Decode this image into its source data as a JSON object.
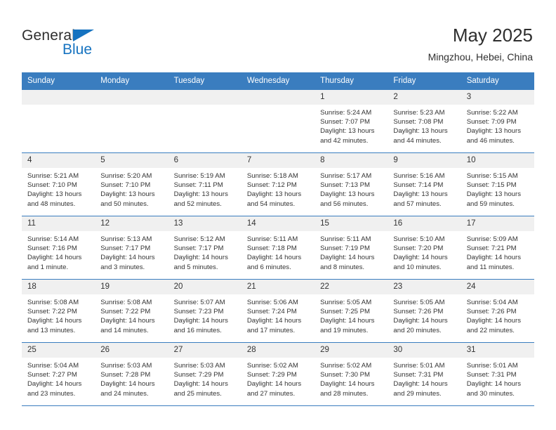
{
  "brand": {
    "word1": "General",
    "word2": "Blue",
    "triangle_color": "#1673c0"
  },
  "header": {
    "title": "May 2025",
    "subtitle": "Mingzhou, Hebei, China",
    "header_bg": "#3a7dbf",
    "daynum_bg": "#f0f0f0"
  },
  "weekdays": [
    "Sunday",
    "Monday",
    "Tuesday",
    "Wednesday",
    "Thursday",
    "Friday",
    "Saturday"
  ],
  "labels": {
    "sunrise": "Sunrise:",
    "sunset": "Sunset:",
    "daylight": "Daylight:"
  },
  "weeks": [
    [
      {
        "day": "",
        "empty": true
      },
      {
        "day": "",
        "empty": true
      },
      {
        "day": "",
        "empty": true
      },
      {
        "day": "",
        "empty": true
      },
      {
        "day": "1",
        "sunrise": "Sunrise: 5:24 AM",
        "sunset": "Sunset: 7:07 PM",
        "daylight": "Daylight: 13 hours and 42 minutes."
      },
      {
        "day": "2",
        "sunrise": "Sunrise: 5:23 AM",
        "sunset": "Sunset: 7:08 PM",
        "daylight": "Daylight: 13 hours and 44 minutes."
      },
      {
        "day": "3",
        "sunrise": "Sunrise: 5:22 AM",
        "sunset": "Sunset: 7:09 PM",
        "daylight": "Daylight: 13 hours and 46 minutes."
      }
    ],
    [
      {
        "day": "4",
        "sunrise": "Sunrise: 5:21 AM",
        "sunset": "Sunset: 7:10 PM",
        "daylight": "Daylight: 13 hours and 48 minutes."
      },
      {
        "day": "5",
        "sunrise": "Sunrise: 5:20 AM",
        "sunset": "Sunset: 7:10 PM",
        "daylight": "Daylight: 13 hours and 50 minutes."
      },
      {
        "day": "6",
        "sunrise": "Sunrise: 5:19 AM",
        "sunset": "Sunset: 7:11 PM",
        "daylight": "Daylight: 13 hours and 52 minutes."
      },
      {
        "day": "7",
        "sunrise": "Sunrise: 5:18 AM",
        "sunset": "Sunset: 7:12 PM",
        "daylight": "Daylight: 13 hours and 54 minutes."
      },
      {
        "day": "8",
        "sunrise": "Sunrise: 5:17 AM",
        "sunset": "Sunset: 7:13 PM",
        "daylight": "Daylight: 13 hours and 56 minutes."
      },
      {
        "day": "9",
        "sunrise": "Sunrise: 5:16 AM",
        "sunset": "Sunset: 7:14 PM",
        "daylight": "Daylight: 13 hours and 57 minutes."
      },
      {
        "day": "10",
        "sunrise": "Sunrise: 5:15 AM",
        "sunset": "Sunset: 7:15 PM",
        "daylight": "Daylight: 13 hours and 59 minutes."
      }
    ],
    [
      {
        "day": "11",
        "sunrise": "Sunrise: 5:14 AM",
        "sunset": "Sunset: 7:16 PM",
        "daylight": "Daylight: 14 hours and 1 minute."
      },
      {
        "day": "12",
        "sunrise": "Sunrise: 5:13 AM",
        "sunset": "Sunset: 7:17 PM",
        "daylight": "Daylight: 14 hours and 3 minutes."
      },
      {
        "day": "13",
        "sunrise": "Sunrise: 5:12 AM",
        "sunset": "Sunset: 7:17 PM",
        "daylight": "Daylight: 14 hours and 5 minutes."
      },
      {
        "day": "14",
        "sunrise": "Sunrise: 5:11 AM",
        "sunset": "Sunset: 7:18 PM",
        "daylight": "Daylight: 14 hours and 6 minutes."
      },
      {
        "day": "15",
        "sunrise": "Sunrise: 5:11 AM",
        "sunset": "Sunset: 7:19 PM",
        "daylight": "Daylight: 14 hours and 8 minutes."
      },
      {
        "day": "16",
        "sunrise": "Sunrise: 5:10 AM",
        "sunset": "Sunset: 7:20 PM",
        "daylight": "Daylight: 14 hours and 10 minutes."
      },
      {
        "day": "17",
        "sunrise": "Sunrise: 5:09 AM",
        "sunset": "Sunset: 7:21 PM",
        "daylight": "Daylight: 14 hours and 11 minutes."
      }
    ],
    [
      {
        "day": "18",
        "sunrise": "Sunrise: 5:08 AM",
        "sunset": "Sunset: 7:22 PM",
        "daylight": "Daylight: 14 hours and 13 minutes."
      },
      {
        "day": "19",
        "sunrise": "Sunrise: 5:08 AM",
        "sunset": "Sunset: 7:22 PM",
        "daylight": "Daylight: 14 hours and 14 minutes."
      },
      {
        "day": "20",
        "sunrise": "Sunrise: 5:07 AM",
        "sunset": "Sunset: 7:23 PM",
        "daylight": "Daylight: 14 hours and 16 minutes."
      },
      {
        "day": "21",
        "sunrise": "Sunrise: 5:06 AM",
        "sunset": "Sunset: 7:24 PM",
        "daylight": "Daylight: 14 hours and 17 minutes."
      },
      {
        "day": "22",
        "sunrise": "Sunrise: 5:05 AM",
        "sunset": "Sunset: 7:25 PM",
        "daylight": "Daylight: 14 hours and 19 minutes."
      },
      {
        "day": "23",
        "sunrise": "Sunrise: 5:05 AM",
        "sunset": "Sunset: 7:26 PM",
        "daylight": "Daylight: 14 hours and 20 minutes."
      },
      {
        "day": "24",
        "sunrise": "Sunrise: 5:04 AM",
        "sunset": "Sunset: 7:26 PM",
        "daylight": "Daylight: 14 hours and 22 minutes."
      }
    ],
    [
      {
        "day": "25",
        "sunrise": "Sunrise: 5:04 AM",
        "sunset": "Sunset: 7:27 PM",
        "daylight": "Daylight: 14 hours and 23 minutes."
      },
      {
        "day": "26",
        "sunrise": "Sunrise: 5:03 AM",
        "sunset": "Sunset: 7:28 PM",
        "daylight": "Daylight: 14 hours and 24 minutes."
      },
      {
        "day": "27",
        "sunrise": "Sunrise: 5:03 AM",
        "sunset": "Sunset: 7:29 PM",
        "daylight": "Daylight: 14 hours and 25 minutes."
      },
      {
        "day": "28",
        "sunrise": "Sunrise: 5:02 AM",
        "sunset": "Sunset: 7:29 PM",
        "daylight": "Daylight: 14 hours and 27 minutes."
      },
      {
        "day": "29",
        "sunrise": "Sunrise: 5:02 AM",
        "sunset": "Sunset: 7:30 PM",
        "daylight": "Daylight: 14 hours and 28 minutes."
      },
      {
        "day": "30",
        "sunrise": "Sunrise: 5:01 AM",
        "sunset": "Sunset: 7:31 PM",
        "daylight": "Daylight: 14 hours and 29 minutes."
      },
      {
        "day": "31",
        "sunrise": "Sunrise: 5:01 AM",
        "sunset": "Sunset: 7:31 PM",
        "daylight": "Daylight: 14 hours and 30 minutes."
      }
    ]
  ]
}
